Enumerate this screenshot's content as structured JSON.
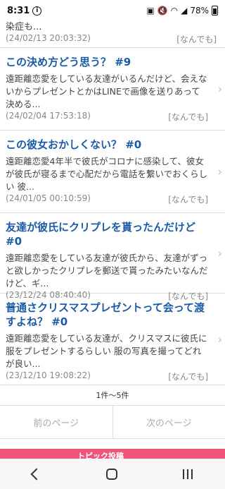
{
  "status": {
    "time": "8:31",
    "battery": "78%"
  },
  "first_item": {
    "excerpt": "染症も...",
    "date": "(24/02/13 20:03:32)",
    "category": "[なんでも]"
  },
  "items": [
    {
      "title": "この決め方どう思う？ #9",
      "excerpt": "遠距離恋愛をしている友達がいるんだけど、会えないからプレゼントとかはLINEで画像を送りあって決める...",
      "date": "(24/02/04 17:53:18)",
      "category": "[なんでも]"
    },
    {
      "title": "この彼女おかしくない？ #0",
      "excerpt": "遠距離恋愛4年半で彼氏がコロナに感染して、彼女が彼氏が寝るまで心配だから電話を繋いでおくらしい 彼...",
      "date": "(24/01/05 00:10:59)",
      "category": "[なんでも]"
    },
    {
      "title": "友達が彼氏にクリプレを貰ったんだけど #0",
      "excerpt": "遠距離恋愛をしている友達が彼氏から、友達がずっと欲しかったクリプレを郵送で貰ったみたいなんだけど、ギ...",
      "date": "(23/12/24 08:40:40)",
      "category": "[なんでも]"
    },
    {
      "title": "普通さクリスマスプレゼントって会って渡すよね？ #0",
      "excerpt": "遠距離恋愛をしている友達が、クリスマスに彼氏に服をプレゼントするらしい 服の写真を撮ってどれが良い...",
      "date": "(23/12/10 19:08:22)",
      "category": "[なんでも]"
    }
  ],
  "pagination": {
    "count": "1件〜5件",
    "prev": "前のページ",
    "next": "次のページ"
  },
  "bottom_banner": {
    "text": "トピック投稿"
  }
}
